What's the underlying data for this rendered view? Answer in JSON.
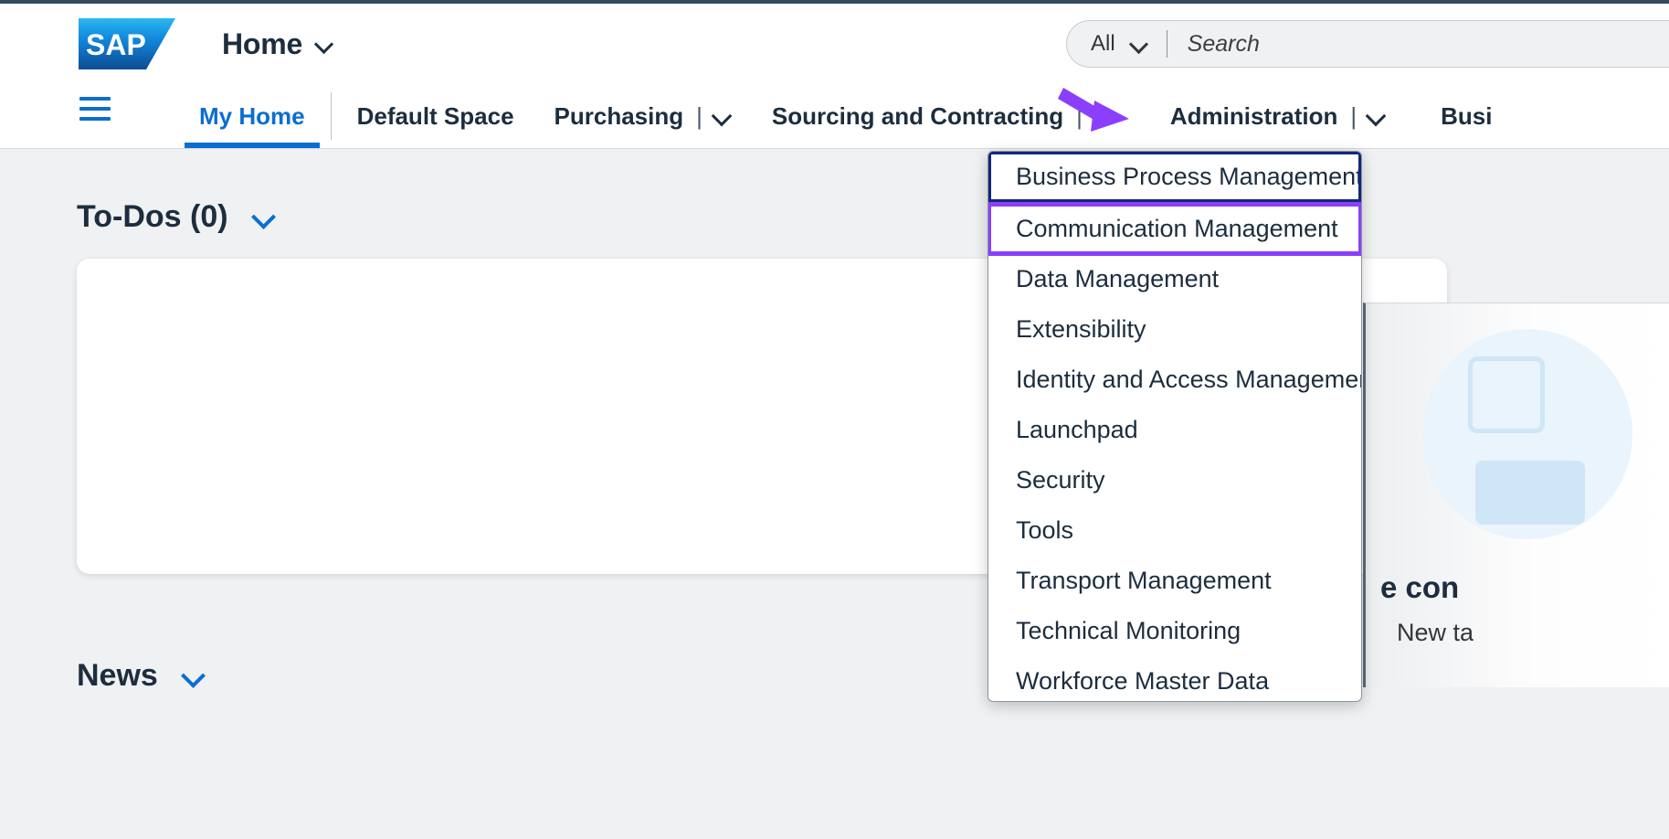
{
  "header": {
    "logo_alt": "SAP",
    "app_title": "Home",
    "app_title_chevron": "chevron-down-icon",
    "search": {
      "scope_label": "All",
      "scope_chevron": "chevron-down-icon",
      "placeholder": "Search",
      "value": ""
    }
  },
  "navbar": {
    "menu_icon": "hamburger-icon",
    "items": [
      {
        "label": "My Home",
        "active": true,
        "has_dropdown": false
      },
      {
        "label": "Default Space",
        "active": false,
        "has_dropdown": false
      },
      {
        "label": "Purchasing",
        "active": false,
        "has_dropdown": true
      },
      {
        "label": "Sourcing and Contracting",
        "active": false,
        "has_dropdown": true
      },
      {
        "label": "Administration",
        "active": false,
        "has_dropdown": true
      },
      {
        "label": "Busi",
        "active": false,
        "has_dropdown": false
      }
    ]
  },
  "dropdown": {
    "owner": "Administration",
    "items": [
      {
        "label": "Business Process Management",
        "highlight": "blue"
      },
      {
        "label": "Communication Management",
        "highlight": "purple"
      },
      {
        "label": "Data Management",
        "highlight": "none"
      },
      {
        "label": "Extensibility",
        "highlight": "none"
      },
      {
        "label": "Identity and Access Management",
        "highlight": "none"
      },
      {
        "label": "Launchpad",
        "highlight": "none"
      },
      {
        "label": "Security",
        "highlight": "none"
      },
      {
        "label": "Tools",
        "highlight": "none"
      },
      {
        "label": "Transport Management",
        "highlight": "none"
      },
      {
        "label": "Technical Monitoring",
        "highlight": "none"
      },
      {
        "label": "Workforce Master Data",
        "highlight": "none"
      }
    ]
  },
  "content": {
    "todos": {
      "title": "To-Dos (0)",
      "collapse_icon": "chevron-down-icon"
    },
    "news": {
      "title": "News",
      "collapse_icon": "chevron-down-icon"
    },
    "right_tile": {
      "title": "e con",
      "subtitle": "New ta",
      "illustration": "document-illustration"
    }
  },
  "annotation": {
    "arrow_color": "#8b3ffd",
    "arrow_target": "Administration",
    "highlight_blue": "#11287b",
    "highlight_purple": "#8b3ffd"
  },
  "colors": {
    "accent": "#0a6ed1",
    "text": "#1d2d3e",
    "page_bg": "#eff1f2",
    "shell_bg": "#ffffff"
  }
}
